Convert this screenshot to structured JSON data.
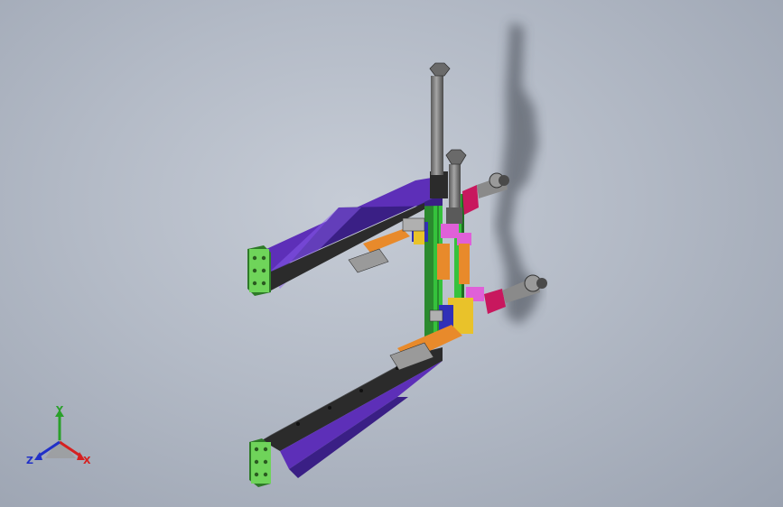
{
  "viewport": {
    "background_top": "#c6ccd6",
    "background_bottom": "#9aa2b0"
  },
  "model": {
    "colors": {
      "arm_purple": "#6a36c8",
      "arm_dark": "#2b2b2b",
      "plate_green": "#6fd45a",
      "rail_green": "#35c23c",
      "cylinder_gray": "#7d7d7d",
      "magenta": "#c8185e",
      "orange": "#e88a2b",
      "yellow": "#e9c22a",
      "pink": "#e060d8",
      "blue": "#3030b8"
    }
  },
  "triad": {
    "x_label": "X",
    "y_label": "Y",
    "z_label": "Z",
    "x_color": "#d62020",
    "y_color": "#2aa02a",
    "z_color": "#2030c8"
  }
}
